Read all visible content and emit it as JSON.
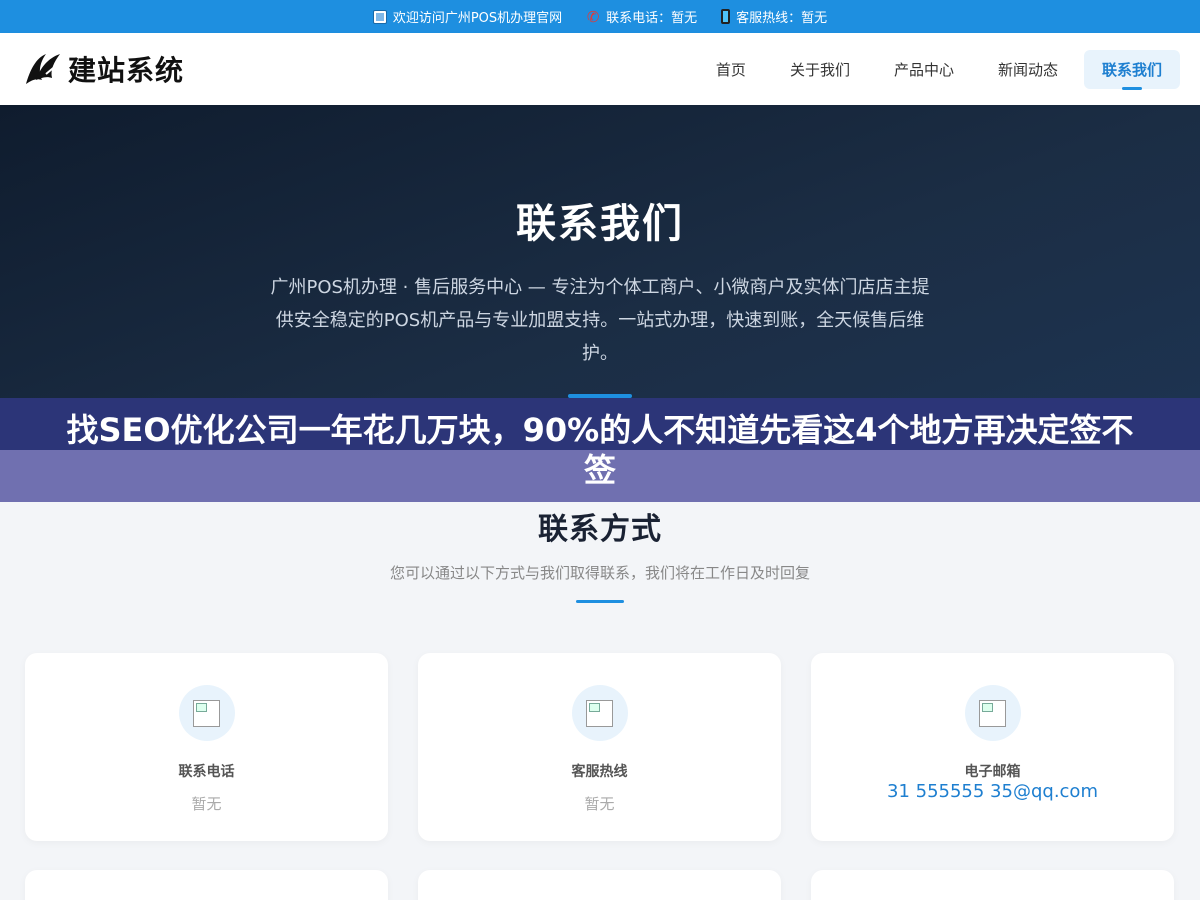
{
  "topbar": {
    "welcome": "欢迎访问广州POS机办理官网",
    "phone": "联系电话：暂无",
    "hotline": "客服热线：暂无"
  },
  "header": {
    "logo_text": "建站系统",
    "nav": [
      {
        "label": "首页"
      },
      {
        "label": "关于我们"
      },
      {
        "label": "产品中心"
      },
      {
        "label": "新闻动态"
      },
      {
        "label": "联系我们",
        "active": true
      }
    ]
  },
  "hero": {
    "title": "联系我们",
    "description": "广州POS机办理 · 售后服务中心 — 专注为个体工商户、小微商户及实体门店店主提供安全稳定的POS机产品与专业加盟支持。一站式办理，快速到账，全天候售后维护。"
  },
  "banner": {
    "title": "找SEO优化公司一年花几万块，90%的人不知道先看这4个地方再决定签不签"
  },
  "contact": {
    "title": "联系方式",
    "subtitle": "您可以通过以下方式与我们取得联系，我们将在工作日及时回复",
    "cards": [
      {
        "icon": "phone-icon",
        "label": "联系电话",
        "value": "暂无"
      },
      {
        "icon": "service-icon",
        "label": "客服热线",
        "value": "暂无"
      },
      {
        "icon": "email-icon",
        "label": "电子邮箱",
        "value": "31 555555 35@qq.com"
      }
    ]
  },
  "colors": {
    "accent": "#1e8fe0",
    "hero_bg": "#1b2d44",
    "banner_top": "#2c3578",
    "banner_bottom": "#7070b0"
  }
}
